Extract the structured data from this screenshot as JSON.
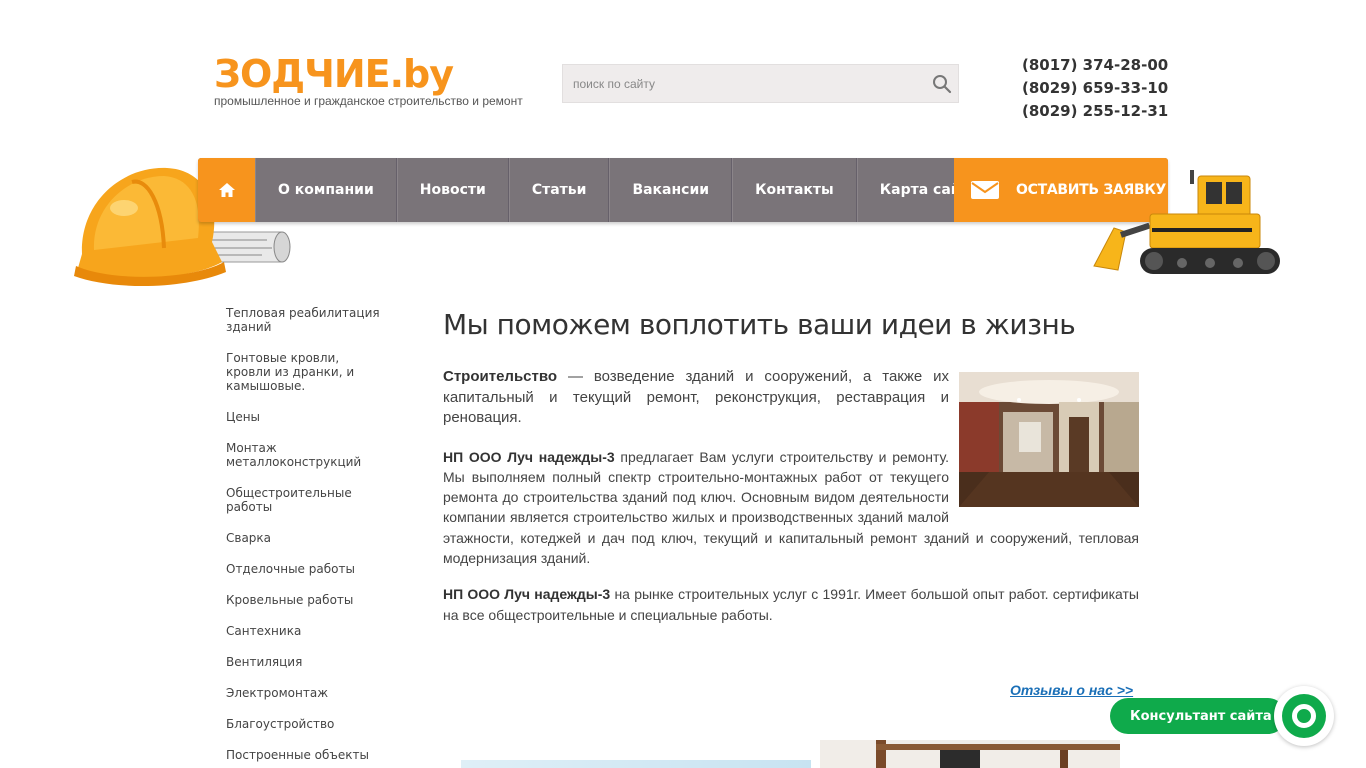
{
  "header": {
    "logo": "ЗОДЧИЕ.by",
    "tagline": "промышленное и гражданское строительство и ремонт",
    "search_placeholder": "поиск по сайту",
    "phones": [
      "(8017) 374-28-00",
      "(8029) 659-33-10",
      "(8029) 255-12-31"
    ]
  },
  "nav": {
    "home_icon": "home-icon",
    "items": [
      "О компании",
      "Новости",
      "Статьи",
      "Вакансии",
      "Контакты",
      "Карта сайта"
    ],
    "cta_label": "ОСТАВИТЬ ЗАЯВКУ",
    "cta_icon": "envelope-icon"
  },
  "sidebar": {
    "items": [
      "Тепловая реабилитация зданий",
      "Гонтовые кровли, кровли из дранки, и камышовые.",
      "Цены",
      "Монтаж металлоконструкций",
      "Общестроительные работы",
      "Сварка",
      "Отделочные работы",
      "Кровельные работы",
      "Сантехника",
      "Вентиляция",
      "Электромонтаж",
      "Благоустройство",
      "Построенные объекты"
    ]
  },
  "main": {
    "title": "Мы поможем воплотить ваши идеи в жизнь",
    "p1_bold": "Строительство",
    "p1_text": " — возведение зданий и сооружений, а также их капитальный  и текущий ремонт, реконструкция, реставрация и реновация.",
    "p2_bold": "НП ООО Луч надежды-3",
    "p2_text": " предлагает Вам услуги строительству и ремонту. Мы выполняем полный спектр строительно-монтажных работ от текущего ремонта до строительства  зданий под ключ. Основным видом деятельности компании является строительство жилых и производственных зданий малой этажности, котеджей и дач под  ключ,  текущий и капитальный ремонт зданий и сооружений,  тепловая модернизация зданий.",
    "p3_bold": "НП ООО Луч надежды-3",
    "p3_text": "  на рынке строительных  услуг с 1991г.  Имеет большой опыт работ. сертификаты  на все общестроительные и специальные работы.",
    "reviews_link": "Отзывы о нас >>"
  },
  "consultant": {
    "label": "Консультант сайта"
  },
  "colors": {
    "accent": "#f7941d",
    "nav_bg": "#7a7479",
    "link": "#1a6fb7",
    "consultant": "#0faa4b"
  }
}
